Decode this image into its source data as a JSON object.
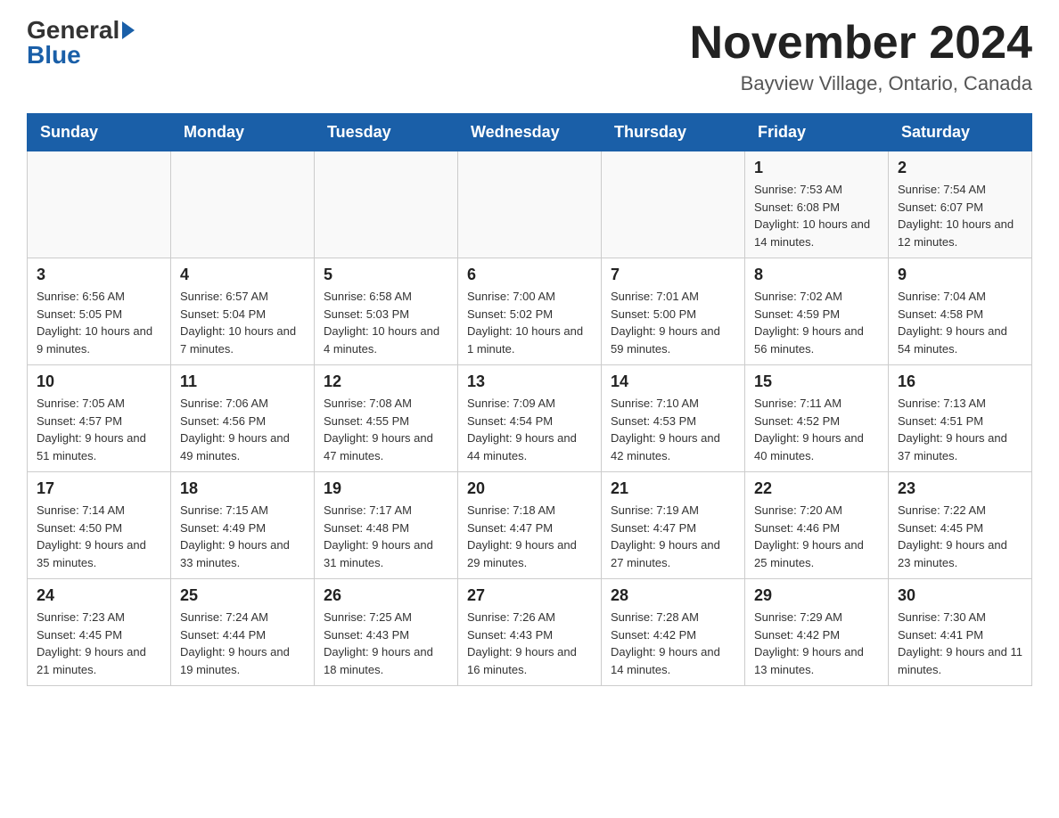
{
  "header": {
    "logo_general": "General",
    "logo_blue": "Blue",
    "month_title": "November 2024",
    "location": "Bayview Village, Ontario, Canada"
  },
  "days_of_week": [
    "Sunday",
    "Monday",
    "Tuesday",
    "Wednesday",
    "Thursday",
    "Friday",
    "Saturday"
  ],
  "weeks": [
    [
      {
        "day": "",
        "info": ""
      },
      {
        "day": "",
        "info": ""
      },
      {
        "day": "",
        "info": ""
      },
      {
        "day": "",
        "info": ""
      },
      {
        "day": "",
        "info": ""
      },
      {
        "day": "1",
        "info": "Sunrise: 7:53 AM\nSunset: 6:08 PM\nDaylight: 10 hours and 14 minutes."
      },
      {
        "day": "2",
        "info": "Sunrise: 7:54 AM\nSunset: 6:07 PM\nDaylight: 10 hours and 12 minutes."
      }
    ],
    [
      {
        "day": "3",
        "info": "Sunrise: 6:56 AM\nSunset: 5:05 PM\nDaylight: 10 hours and 9 minutes."
      },
      {
        "day": "4",
        "info": "Sunrise: 6:57 AM\nSunset: 5:04 PM\nDaylight: 10 hours and 7 minutes."
      },
      {
        "day": "5",
        "info": "Sunrise: 6:58 AM\nSunset: 5:03 PM\nDaylight: 10 hours and 4 minutes."
      },
      {
        "day": "6",
        "info": "Sunrise: 7:00 AM\nSunset: 5:02 PM\nDaylight: 10 hours and 1 minute."
      },
      {
        "day": "7",
        "info": "Sunrise: 7:01 AM\nSunset: 5:00 PM\nDaylight: 9 hours and 59 minutes."
      },
      {
        "day": "8",
        "info": "Sunrise: 7:02 AM\nSunset: 4:59 PM\nDaylight: 9 hours and 56 minutes."
      },
      {
        "day": "9",
        "info": "Sunrise: 7:04 AM\nSunset: 4:58 PM\nDaylight: 9 hours and 54 minutes."
      }
    ],
    [
      {
        "day": "10",
        "info": "Sunrise: 7:05 AM\nSunset: 4:57 PM\nDaylight: 9 hours and 51 minutes."
      },
      {
        "day": "11",
        "info": "Sunrise: 7:06 AM\nSunset: 4:56 PM\nDaylight: 9 hours and 49 minutes."
      },
      {
        "day": "12",
        "info": "Sunrise: 7:08 AM\nSunset: 4:55 PM\nDaylight: 9 hours and 47 minutes."
      },
      {
        "day": "13",
        "info": "Sunrise: 7:09 AM\nSunset: 4:54 PM\nDaylight: 9 hours and 44 minutes."
      },
      {
        "day": "14",
        "info": "Sunrise: 7:10 AM\nSunset: 4:53 PM\nDaylight: 9 hours and 42 minutes."
      },
      {
        "day": "15",
        "info": "Sunrise: 7:11 AM\nSunset: 4:52 PM\nDaylight: 9 hours and 40 minutes."
      },
      {
        "day": "16",
        "info": "Sunrise: 7:13 AM\nSunset: 4:51 PM\nDaylight: 9 hours and 37 minutes."
      }
    ],
    [
      {
        "day": "17",
        "info": "Sunrise: 7:14 AM\nSunset: 4:50 PM\nDaylight: 9 hours and 35 minutes."
      },
      {
        "day": "18",
        "info": "Sunrise: 7:15 AM\nSunset: 4:49 PM\nDaylight: 9 hours and 33 minutes."
      },
      {
        "day": "19",
        "info": "Sunrise: 7:17 AM\nSunset: 4:48 PM\nDaylight: 9 hours and 31 minutes."
      },
      {
        "day": "20",
        "info": "Sunrise: 7:18 AM\nSunset: 4:47 PM\nDaylight: 9 hours and 29 minutes."
      },
      {
        "day": "21",
        "info": "Sunrise: 7:19 AM\nSunset: 4:47 PM\nDaylight: 9 hours and 27 minutes."
      },
      {
        "day": "22",
        "info": "Sunrise: 7:20 AM\nSunset: 4:46 PM\nDaylight: 9 hours and 25 minutes."
      },
      {
        "day": "23",
        "info": "Sunrise: 7:22 AM\nSunset: 4:45 PM\nDaylight: 9 hours and 23 minutes."
      }
    ],
    [
      {
        "day": "24",
        "info": "Sunrise: 7:23 AM\nSunset: 4:45 PM\nDaylight: 9 hours and 21 minutes."
      },
      {
        "day": "25",
        "info": "Sunrise: 7:24 AM\nSunset: 4:44 PM\nDaylight: 9 hours and 19 minutes."
      },
      {
        "day": "26",
        "info": "Sunrise: 7:25 AM\nSunset: 4:43 PM\nDaylight: 9 hours and 18 minutes."
      },
      {
        "day": "27",
        "info": "Sunrise: 7:26 AM\nSunset: 4:43 PM\nDaylight: 9 hours and 16 minutes."
      },
      {
        "day": "28",
        "info": "Sunrise: 7:28 AM\nSunset: 4:42 PM\nDaylight: 9 hours and 14 minutes."
      },
      {
        "day": "29",
        "info": "Sunrise: 7:29 AM\nSunset: 4:42 PM\nDaylight: 9 hours and 13 minutes."
      },
      {
        "day": "30",
        "info": "Sunrise: 7:30 AM\nSunset: 4:41 PM\nDaylight: 9 hours and 11 minutes."
      }
    ]
  ]
}
